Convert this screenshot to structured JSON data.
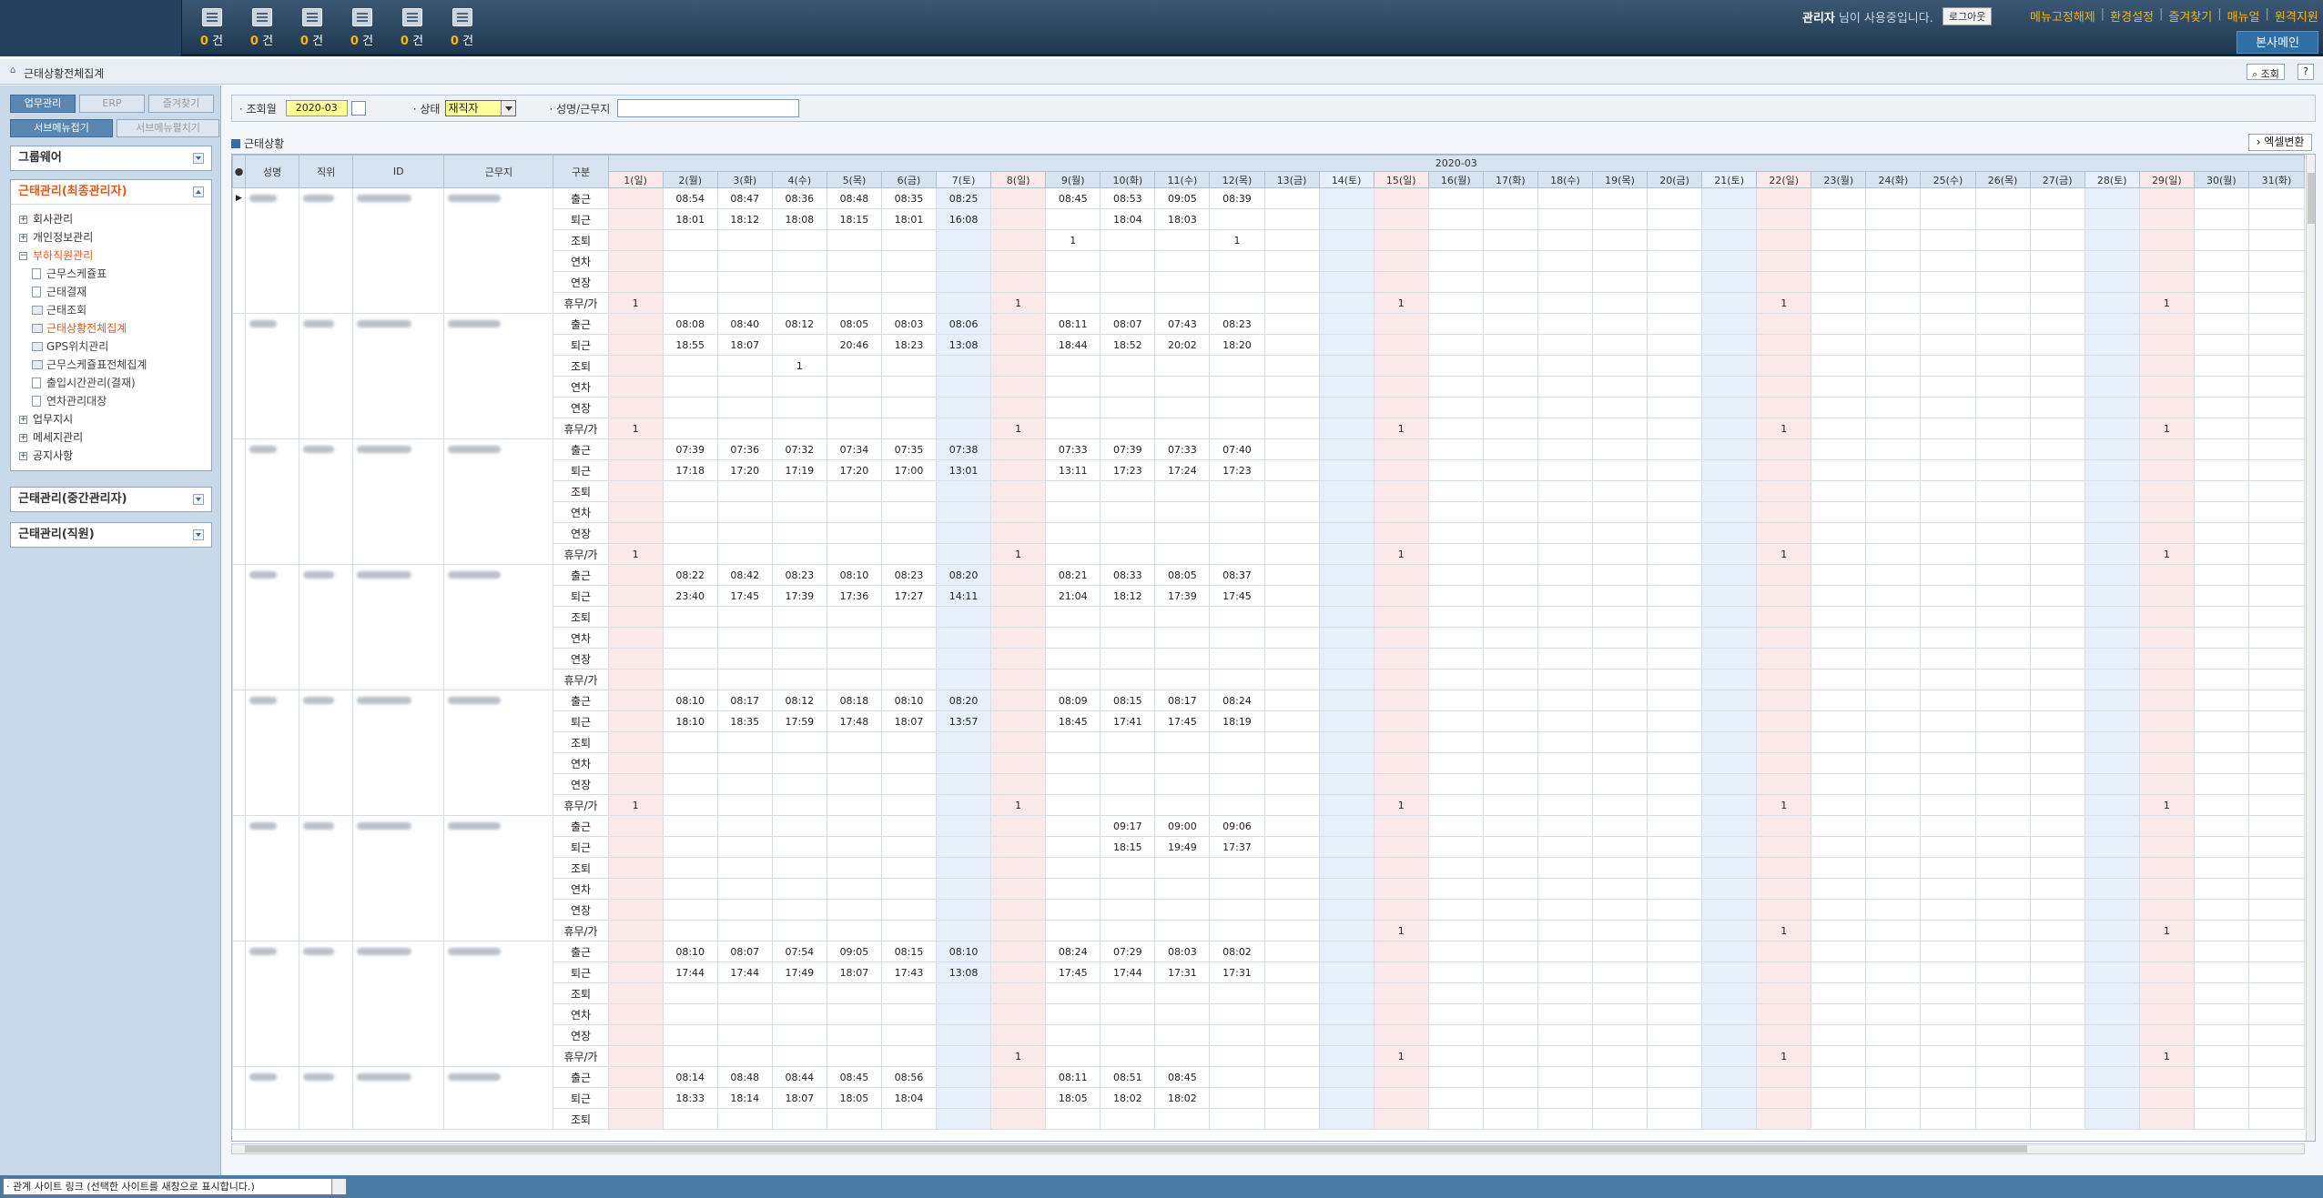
{
  "header": {
    "counts": [
      "0",
      "0",
      "0",
      "0",
      "0",
      "0"
    ],
    "count_unit": "건",
    "user_name": "관리자",
    "user_suffix": "님이 사용중입니다.",
    "logout": "로그아웃",
    "links": [
      "메뉴고정해제",
      "환경설정",
      "즐겨찾기",
      "매뉴얼",
      "원격지원"
    ],
    "branch_button": "본사메인"
  },
  "breadcrumb": {
    "title": "근태상황전체집계",
    "search_btn": "조회",
    "help_btn": "?"
  },
  "sidebar": {
    "tabs1": [
      "업무관리",
      "ERP",
      "즐겨찾기"
    ],
    "tabs2": [
      "서브메뉴접기",
      "서브메뉴펼치기"
    ],
    "groupware": "그룹웨어",
    "attendance_top": "근태관리(최종관리자)",
    "tree_items": [
      {
        "label": "회사관리",
        "kind": "plus",
        "sub": false
      },
      {
        "label": "개인정보관리",
        "kind": "plus",
        "sub": false
      },
      {
        "label": "부하직원관리",
        "kind": "minus",
        "sub": false,
        "selected": true
      },
      {
        "label": "근무스케쥴표",
        "kind": "leaf",
        "sub": true
      },
      {
        "label": "근태결재",
        "kind": "leaf",
        "sub": true
      },
      {
        "label": "근태조회",
        "kind": "print",
        "sub": true
      },
      {
        "label": "근태상황전체집계",
        "kind": "print",
        "sub": true,
        "selected": true
      },
      {
        "label": "GPS위치관리",
        "kind": "print",
        "sub": true
      },
      {
        "label": "근무스케쥴표전체집계",
        "kind": "print",
        "sub": true
      },
      {
        "label": "출입시간관리(결재)",
        "kind": "leaf",
        "sub": true
      },
      {
        "label": "연차관리대장",
        "kind": "leaf",
        "sub": true
      },
      {
        "label": "업무지시",
        "kind": "plus",
        "sub": false
      },
      {
        "label": "메세지관리",
        "kind": "plus",
        "sub": false
      },
      {
        "label": "공지사항",
        "kind": "plus",
        "sub": false
      }
    ],
    "attendance_mid": "근태관리(중간관리자)",
    "attendance_staff": "근태관리(직원)"
  },
  "conditions": {
    "month_label": "· 조회월",
    "month_value": "2020-03",
    "status_label": "· 상태",
    "status_value": "재직자",
    "name_label": "· 성명/근무지"
  },
  "section": {
    "title": "근태상황",
    "excel": "엑셀변환"
  },
  "grid": {
    "month": "2020-03",
    "headers": [
      "성명",
      "직위",
      "ID",
      "근무지",
      "구분"
    ],
    "days": [
      "1(일)",
      "2(월)",
      "3(화)",
      "4(수)",
      "5(목)",
      "6(금)",
      "7(토)",
      "8(일)",
      "9(월)",
      "10(화)",
      "11(수)",
      "12(목)",
      "13(금)",
      "14(토)",
      "15(일)",
      "16(월)",
      "17(화)",
      "18(수)",
      "19(목)",
      "20(금)",
      "21(토)",
      "22(일)",
      "23(월)",
      "24(화)",
      "25(수)",
      "26(목)",
      "27(금)",
      "28(토)",
      "29(일)",
      "30(월)",
      "31(화)"
    ],
    "kinds": [
      "출근",
      "퇴근",
      "조퇴",
      "연차",
      "연장",
      "휴무/가"
    ],
    "employees": [
      {
        "rows": [
          [
            "",
            "08:54",
            "08:47",
            "08:36",
            "08:48",
            "08:35",
            "08:25",
            "",
            "08:45",
            "08:53",
            "09:05",
            "08:39"
          ],
          [
            "",
            "18:01",
            "18:12",
            "18:08",
            "18:15",
            "18:01",
            "16:08",
            "",
            "",
            "18:04",
            "18:03",
            ""
          ],
          [
            "",
            "",
            "",
            "",
            "",
            "",
            "",
            "",
            "1",
            "",
            "",
            "1"
          ],
          [],
          [],
          [
            "1",
            "",
            "",
            "",
            "",
            "",
            "",
            "1",
            "",
            "",
            "",
            "",
            "",
            "",
            "1",
            "",
            "",
            "",
            "",
            "",
            "",
            "1",
            "",
            "",
            "",
            "",
            "",
            "",
            "1"
          ]
        ]
      },
      {
        "rows": [
          [
            "",
            "08:08",
            "08:40",
            "08:12",
            "08:05",
            "08:03",
            "08:06",
            "",
            "08:11",
            "08:07",
            "07:43",
            "08:23"
          ],
          [
            "",
            "18:55",
            "18:07",
            "",
            "20:46",
            "18:23",
            "13:08",
            "",
            "18:44",
            "18:52",
            "20:02",
            "18:20"
          ],
          [
            "",
            "",
            "",
            "1"
          ],
          [],
          [],
          [
            "1",
            "",
            "",
            "",
            "",
            "",
            "",
            "1",
            "",
            "",
            "",
            "",
            "",
            "",
            "1",
            "",
            "",
            "",
            "",
            "",
            "",
            "1",
            "",
            "",
            "",
            "",
            "",
            "",
            "1"
          ]
        ]
      },
      {
        "rows": [
          [
            "",
            "07:39",
            "07:36",
            "07:32",
            "07:34",
            "07:35",
            "07:38",
            "",
            "07:33",
            "07:39",
            "07:33",
            "07:40"
          ],
          [
            "",
            "17:18",
            "17:20",
            "17:19",
            "17:20",
            "17:00",
            "13:01",
            "",
            "13:11",
            "17:23",
            "17:24",
            "17:23"
          ],
          [],
          [],
          [],
          [
            "1",
            "",
            "",
            "",
            "",
            "",
            "",
            "1",
            "",
            "",
            "",
            "",
            "",
            "",
            "1",
            "",
            "",
            "",
            "",
            "",
            "",
            "1",
            "",
            "",
            "",
            "",
            "",
            "",
            "1"
          ]
        ]
      },
      {
        "rows": [
          [
            "",
            "08:22",
            "08:42",
            "08:23",
            "08:10",
            "08:23",
            "08:20",
            "",
            "08:21",
            "08:33",
            "08:05",
            "08:37"
          ],
          [
            "",
            "23:40",
            "17:45",
            "17:39",
            "17:36",
            "17:27",
            "14:11",
            "",
            "21:04",
            "18:12",
            "17:39",
            "17:45"
          ],
          [],
          [],
          [],
          []
        ]
      },
      {
        "rows": [
          [
            "",
            "08:10",
            "08:17",
            "08:12",
            "08:18",
            "08:10",
            "08:20",
            "",
            "08:09",
            "08:15",
            "08:17",
            "08:24"
          ],
          [
            "",
            "18:10",
            "18:35",
            "17:59",
            "17:48",
            "18:07",
            "13:57",
            "",
            "18:45",
            "17:41",
            "17:45",
            "18:19"
          ],
          [],
          [],
          [],
          [
            "1",
            "",
            "",
            "",
            "",
            "",
            "",
            "1",
            "",
            "",
            "",
            "",
            "",
            "",
            "1",
            "",
            "",
            "",
            "",
            "",
            "",
            "1",
            "",
            "",
            "",
            "",
            "",
            "",
            "1"
          ]
        ]
      },
      {
        "rows": [
          [
            "",
            "",
            "",
            "",
            "",
            "",
            "",
            "",
            "",
            "09:17",
            "09:00",
            "09:06"
          ],
          [
            "",
            "",
            "",
            "",
            "",
            "",
            "",
            "",
            "",
            "18:15",
            "19:49",
            "17:37"
          ],
          [],
          [],
          [],
          [
            "",
            "",
            "",
            "",
            "",
            "",
            "",
            "",
            "",
            "",
            "",
            "",
            "",
            "",
            "1",
            "",
            "",
            "",
            "",
            "",
            "",
            "1",
            "",
            "",
            "",
            "",
            "",
            "",
            "1"
          ]
        ]
      },
      {
        "rows": [
          [
            "",
            "08:10",
            "08:07",
            "07:54",
            "09:05",
            "08:15",
            "08:10",
            "",
            "08:24",
            "07:29",
            "08:03",
            "08:02"
          ],
          [
            "",
            "17:44",
            "17:44",
            "17:49",
            "18:07",
            "17:43",
            "13:08",
            "",
            "17:45",
            "17:44",
            "17:31",
            "17:31"
          ],
          [],
          [],
          [],
          [
            "",
            "",
            "",
            "",
            "",
            "",
            "",
            "1",
            "",
            "",
            "",
            "",
            "",
            "",
            "1",
            "",
            "",
            "",
            "",
            "",
            "",
            "1",
            "",
            "",
            "",
            "",
            "",
            "",
            "1"
          ]
        ]
      },
      {
        "rows": [
          [
            "",
            "08:14",
            "08:48",
            "08:44",
            "08:45",
            "08:56",
            "",
            "",
            "08:11",
            "08:51",
            "08:45"
          ],
          [
            "",
            "18:33",
            "18:14",
            "18:07",
            "18:05",
            "18:04",
            "",
            "",
            "18:05",
            "18:02",
            "18:02"
          ],
          []
        ]
      }
    ]
  },
  "footer": {
    "related_site": "· 관계 사이트 링크 (선택한 사이트를 새창으로 표시합니다.)"
  },
  "colors": {
    "accent": "#2f6fa6",
    "header_bg": "#1e3850",
    "sunday_bg": "#fbe8e8",
    "saturday_bg": "#e7f0fa",
    "highlight": "#e2591a"
  }
}
